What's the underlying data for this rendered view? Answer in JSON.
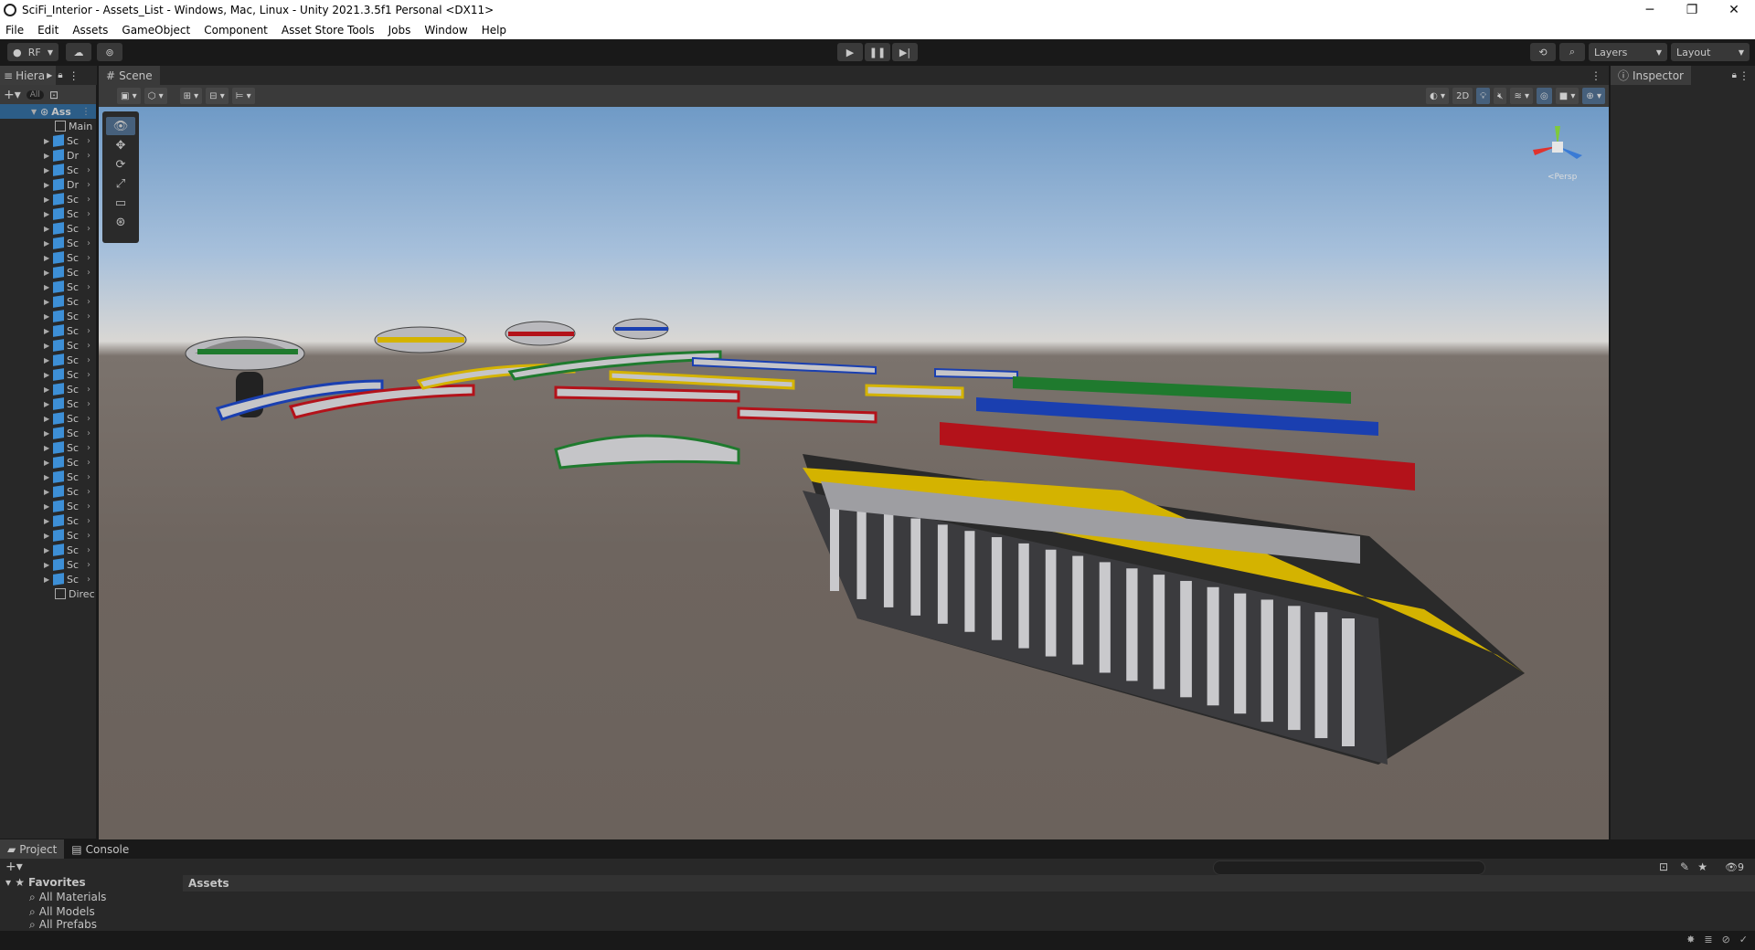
{
  "window": {
    "title": "SciFi_Interior - Assets_List - Windows, Mac, Linux - Unity 2021.3.5f1 Personal <DX11>",
    "controls": [
      "─",
      "❐",
      "✕"
    ]
  },
  "menu": [
    "File",
    "Edit",
    "Assets",
    "GameObject",
    "Component",
    "Asset Store Tools",
    "Jobs",
    "Window",
    "Help"
  ],
  "toolbar": {
    "account": "RF",
    "layers": "Layers",
    "layout": "Layout"
  },
  "hierarchy": {
    "tab": "Hiera",
    "search_placeholder": "All",
    "root": "Ass",
    "main_camera": "Main",
    "directional_light": "Direc",
    "items": [
      "Sc",
      "Dr",
      "Sc",
      "Dr",
      "Sc",
      "Sc",
      "Sc",
      "Sc",
      "Sc",
      "Sc",
      "Sc",
      "Sc",
      "Sc",
      "Sc",
      "Sc",
      "Sc",
      "Sc",
      "Sc",
      "Sc",
      "Sc",
      "Sc",
      "Sc",
      "Sc",
      "Sc",
      "Sc",
      "Sc",
      "Sc",
      "Sc",
      "Sc",
      "Sc",
      "Sc"
    ]
  },
  "scene": {
    "tab": "Scene",
    "mode_2d": "2D",
    "persp_label": "<Persp"
  },
  "inspector": {
    "tab": "Inspector"
  },
  "project": {
    "tab_project": "Project",
    "tab_console": "Console",
    "favorites": "Favorites",
    "fav_items": [
      "All Materials",
      "All Models",
      "All Prefabs"
    ],
    "assets_header": "Assets",
    "hidden_count": "9"
  },
  "colors": {
    "accent_blue": "#3d8fd6",
    "bg_dark": "#191919",
    "panel": "#282828",
    "yellow": "#d4b300",
    "red": "#b3121a",
    "blue": "#1a3fb0",
    "green": "#1f7a2e"
  }
}
